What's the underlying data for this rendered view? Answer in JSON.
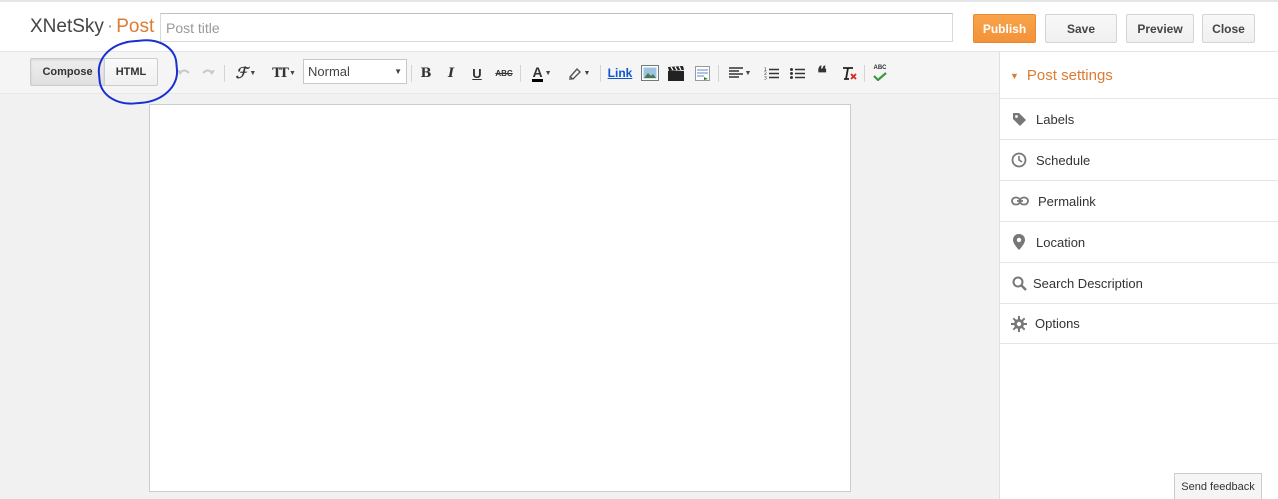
{
  "header": {
    "blog_name": "XNetSky",
    "separator": "·",
    "section": "Post",
    "title_placeholder": "Post title",
    "title_value": "",
    "publish_label": "Publish",
    "save_label": "Save",
    "preview_label": "Preview",
    "close_label": "Close"
  },
  "toolbar": {
    "compose_label": "Compose",
    "html_label": "HTML",
    "active_mode": "Compose",
    "font_size_value": "Normal",
    "link_label": "Link",
    "icons": [
      "undo-icon",
      "redo-icon",
      "font-family-icon",
      "font-size-icon",
      "bold-icon",
      "italic-icon",
      "underline-icon",
      "strikethrough-icon",
      "text-color-icon",
      "highlight-color-icon",
      "insert-image-icon",
      "insert-video-icon",
      "jump-break-icon",
      "align-icon",
      "numbered-list-icon",
      "bulleted-list-icon",
      "quote-icon",
      "remove-formatting-icon",
      "spell-check-icon"
    ],
    "bold_glyph": "B",
    "italic_glyph": "I",
    "underline_glyph": "U",
    "strike_glyph": "ABC",
    "spellcheck_glyph": "ABC",
    "textcolor_glyph": "A",
    "quote_glyph": "❝",
    "font_glyph": "ℱ",
    "size_glyph": "TT"
  },
  "sidebar": {
    "title": "Post settings",
    "items": [
      {
        "label": "Labels",
        "icon": "tag-icon"
      },
      {
        "label": "Schedule",
        "icon": "clock-icon"
      },
      {
        "label": "Permalink",
        "icon": "link-icon"
      },
      {
        "label": "Location",
        "icon": "location-pin-icon"
      },
      {
        "label": "Search Description",
        "icon": "search-icon"
      },
      {
        "label": "Options",
        "icon": "gear-icon"
      }
    ]
  },
  "footer": {
    "feedback_label": "Send feedback"
  },
  "colors": {
    "accent": "#dd7b32",
    "publish": "#f3923a",
    "link": "#1155cc",
    "annotation": "#1a2fd0"
  }
}
